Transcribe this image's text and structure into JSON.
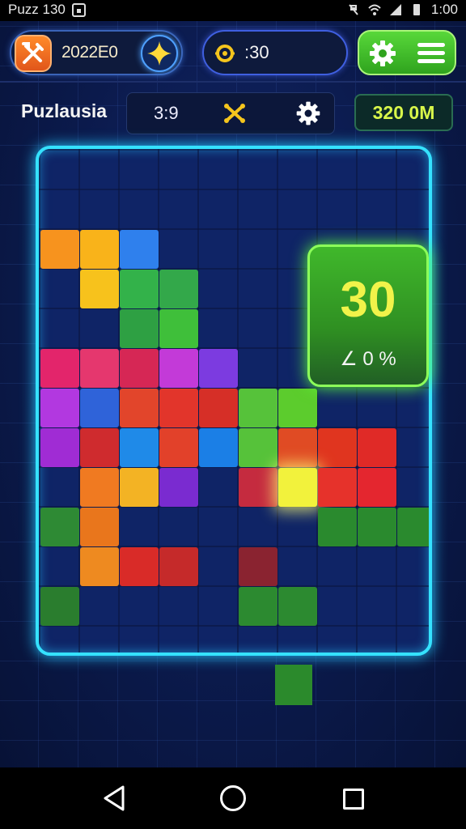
{
  "status_bar": {
    "app_label": "Puzz 130",
    "time": "1:00"
  },
  "hud": {
    "tool_value": "2022E0",
    "coins": ":30",
    "colors": {
      "accent_blue": "#3f5fe0",
      "accent_green": "#4fd035",
      "accent_orange": "#f27020"
    }
  },
  "info_row": {
    "title": "Puzlausia",
    "timer": "3:9",
    "score": "320 0M"
  },
  "overlay": {
    "value": "30",
    "percent": "∠ 0 %"
  },
  "board": {
    "pieces": [
      {
        "c": 0,
        "r": 2,
        "color": "#f7931e"
      },
      {
        "c": 1,
        "r": 2,
        "color": "#f9b31a"
      },
      {
        "c": 2,
        "r": 2,
        "color": "#2f80ed"
      },
      {
        "c": 1,
        "r": 3,
        "color": "#f7c21c"
      },
      {
        "c": 2,
        "r": 3,
        "color": "#33b24a"
      },
      {
        "c": 3,
        "r": 3,
        "color": "#33a84a"
      },
      {
        "c": 2,
        "r": 4,
        "color": "#2ea043"
      },
      {
        "c": 3,
        "r": 4,
        "color": "#3fbf3a"
      },
      {
        "c": 0,
        "r": 5,
        "color": "#e3256b"
      },
      {
        "c": 1,
        "r": 5,
        "color": "#e5376e"
      },
      {
        "c": 2,
        "r": 5,
        "color": "#d62755"
      },
      {
        "c": 3,
        "r": 5,
        "color": "#c33ad8"
      },
      {
        "c": 4,
        "r": 5,
        "color": "#7c3be0"
      },
      {
        "c": 0,
        "r": 6,
        "color": "#b238e0"
      },
      {
        "c": 1,
        "r": 6,
        "color": "#2f63d9"
      },
      {
        "c": 2,
        "r": 6,
        "color": "#e2452b"
      },
      {
        "c": 3,
        "r": 6,
        "color": "#e2352b"
      },
      {
        "c": 4,
        "r": 6,
        "color": "#d62f27"
      },
      {
        "c": 5,
        "r": 6,
        "color": "#56c23a"
      },
      {
        "c": 6,
        "r": 6,
        "color": "#5ccc2d"
      },
      {
        "c": 0,
        "r": 7,
        "color": "#a02cd4"
      },
      {
        "c": 1,
        "r": 7,
        "color": "#cf2b2e"
      },
      {
        "c": 2,
        "r": 7,
        "color": "#1f8ae8"
      },
      {
        "c": 3,
        "r": 7,
        "color": "#e2412a"
      },
      {
        "c": 4,
        "r": 7,
        "color": "#1b7fe6"
      },
      {
        "c": 5,
        "r": 7,
        "color": "#56c23a"
      },
      {
        "c": 6,
        "r": 7,
        "color": "#e04b24"
      },
      {
        "c": 7,
        "r": 7,
        "color": "#e0351f"
      },
      {
        "c": 8,
        "r": 7,
        "color": "#e02a27"
      },
      {
        "c": 1,
        "r": 8,
        "color": "#f07a21"
      },
      {
        "c": 2,
        "r": 8,
        "color": "#f3b324"
      },
      {
        "c": 3,
        "r": 8,
        "color": "#7a2bd0"
      },
      {
        "c": 5,
        "r": 8,
        "color": "#c52b3f"
      },
      {
        "c": 6,
        "r": 8,
        "color": "#f2f23c",
        "glow": true
      },
      {
        "c": 7,
        "r": 8,
        "color": "#e6322b"
      },
      {
        "c": 8,
        "r": 8,
        "color": "#e4262f"
      },
      {
        "c": 0,
        "r": 9,
        "color": "#2e8a34"
      },
      {
        "c": 1,
        "r": 9,
        "color": "#e9761c"
      },
      {
        "c": 7,
        "r": 9,
        "color": "#2a8a2e"
      },
      {
        "c": 8,
        "r": 9,
        "color": "#2a8a2e"
      },
      {
        "c": 9,
        "r": 9,
        "color": "#2a8a2e"
      },
      {
        "c": 1,
        "r": 10,
        "color": "#ee8a20"
      },
      {
        "c": 2,
        "r": 10,
        "color": "#d92b28"
      },
      {
        "c": 3,
        "r": 10,
        "color": "#c52a2a"
      },
      {
        "c": 5,
        "r": 10,
        "color": "#8a2330"
      },
      {
        "c": 0,
        "r": 11,
        "color": "#2a7d2e"
      },
      {
        "c": 5,
        "r": 11,
        "color": "#2c8a30"
      },
      {
        "c": 6,
        "r": 11,
        "color": "#2c8a30"
      }
    ]
  }
}
